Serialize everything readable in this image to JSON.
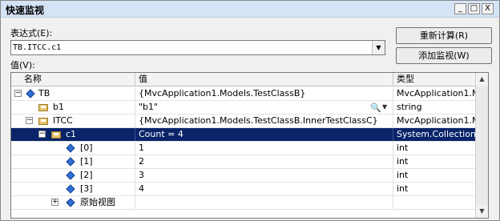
{
  "window": {
    "title": "快速监视",
    "controls": {
      "minimize": "_",
      "maximize": "□",
      "close": "X"
    }
  },
  "expression": {
    "label": "表达式(E):",
    "value": "TB.ITCC.c1"
  },
  "buttons": {
    "recalc": "重新计算(R)",
    "add_watch": "添加监视(W)"
  },
  "value_label": "值(V):",
  "columns": {
    "name": "名称",
    "value": "值",
    "type": "类型"
  },
  "rows": [
    {
      "name": "TB",
      "value": "{MvcApplication1.Models.TestClassB}",
      "type": "MvcApplication1.M",
      "expander": "−",
      "icon": "diamond-icon"
    },
    {
      "name": "b1",
      "value": "\"b1\"",
      "type": "string",
      "expander": "",
      "icon": "field-icon"
    },
    {
      "name": "ITCC",
      "value": "{MvcApplication1.Models.TestClassB.InnerTestClassC}",
      "type": "MvcApplication1.M",
      "expander": "−",
      "icon": "field-icon"
    },
    {
      "name": "c1",
      "value": "Count = 4",
      "type": "System.Collections",
      "expander": "−",
      "icon": "field-icon"
    },
    {
      "name": "[0]",
      "value": "1",
      "type": "int",
      "expander": "",
      "icon": "diamond-icon"
    },
    {
      "name": "[1]",
      "value": "2",
      "type": "int",
      "expander": "",
      "icon": "diamond-icon"
    },
    {
      "name": "[2]",
      "value": "3",
      "type": "int",
      "expander": "",
      "icon": "diamond-icon"
    },
    {
      "name": "[3]",
      "value": "4",
      "type": "int",
      "expander": "",
      "icon": "diamond-icon"
    },
    {
      "name": "原始视图",
      "value": "",
      "type": "",
      "expander": "+",
      "icon": "diamond-icon"
    }
  ],
  "selected_row": 3
}
